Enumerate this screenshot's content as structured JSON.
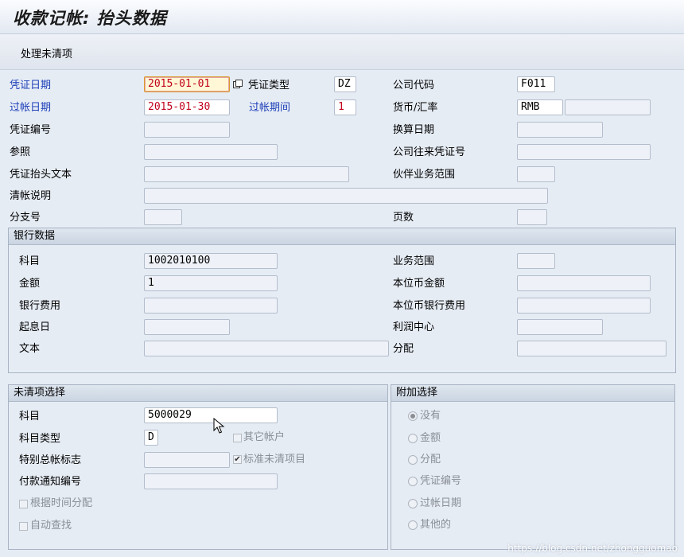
{
  "title": "收款记帐: 抬头数据",
  "toolbar": {
    "process_open_items": "处理未清项"
  },
  "header": {
    "doc_date_label": "凭证日期",
    "doc_date": "2015-01-01",
    "doc_type_label": "凭证类型",
    "doc_type": "DZ",
    "company_code_label": "公司代码",
    "company_code": "F011",
    "posting_date_label": "过帐日期",
    "posting_date": "2015-01-30",
    "period_label": "过帐期间",
    "period": "1",
    "currency_label": "货币/汇率",
    "currency": "RMB",
    "exchange_rate": "",
    "doc_number_label": "凭证编号",
    "doc_number": "",
    "translation_date_label": "换算日期",
    "translation_date": "",
    "reference_label": "参照",
    "reference": "",
    "intercompany_label": "公司往来凭证号",
    "intercompany": "",
    "header_text_label": "凭证抬头文本",
    "header_text": "",
    "partner_ba_label": "伙伴业务范围",
    "partner_ba": "",
    "clearing_text_label": "清帐说明",
    "clearing_text": "",
    "branch_label": "分支号",
    "branch": "",
    "pages_label": "页数",
    "pages": ""
  },
  "bank": {
    "title": "银行数据",
    "account_label": "科目",
    "account": "1002010100",
    "amount_label": "金额",
    "amount": "1",
    "bank_charges_label": "银行费用",
    "bank_charges": "",
    "value_date_label": "起息日",
    "value_date": "",
    "text_label": "文本",
    "text": "",
    "business_area_label": "业务范围",
    "business_area": "",
    "lc_amount_label": "本位币金额",
    "lc_amount": "",
    "lc_bank_charges_label": "本位币银行费用",
    "lc_bank_charges": "",
    "profit_center_label": "利润中心",
    "profit_center": "",
    "assignment_label": "分配",
    "assignment": ""
  },
  "open_items": {
    "title": "未清项选择",
    "account_label": "科目",
    "account": "5000029",
    "account_type_label": "科目类型",
    "account_type": "D",
    "other_accounts_label": "其它帐户",
    "special_gl_label": "特别总帐标志",
    "special_gl": "",
    "standard_oi_label": "标准未清项目",
    "payment_advice_label": "付款通知编号",
    "payment_advice": "",
    "dist_by_age_label": "根据时间分配",
    "auto_search_label": "自动查找"
  },
  "additional": {
    "title": "附加选择",
    "options": [
      "没有",
      "金额",
      "分配",
      "凭证编号",
      "过帐日期",
      "其他的"
    ],
    "selected": "没有"
  },
  "watermark": "https://blog.csdn.net/zhongguomao"
}
